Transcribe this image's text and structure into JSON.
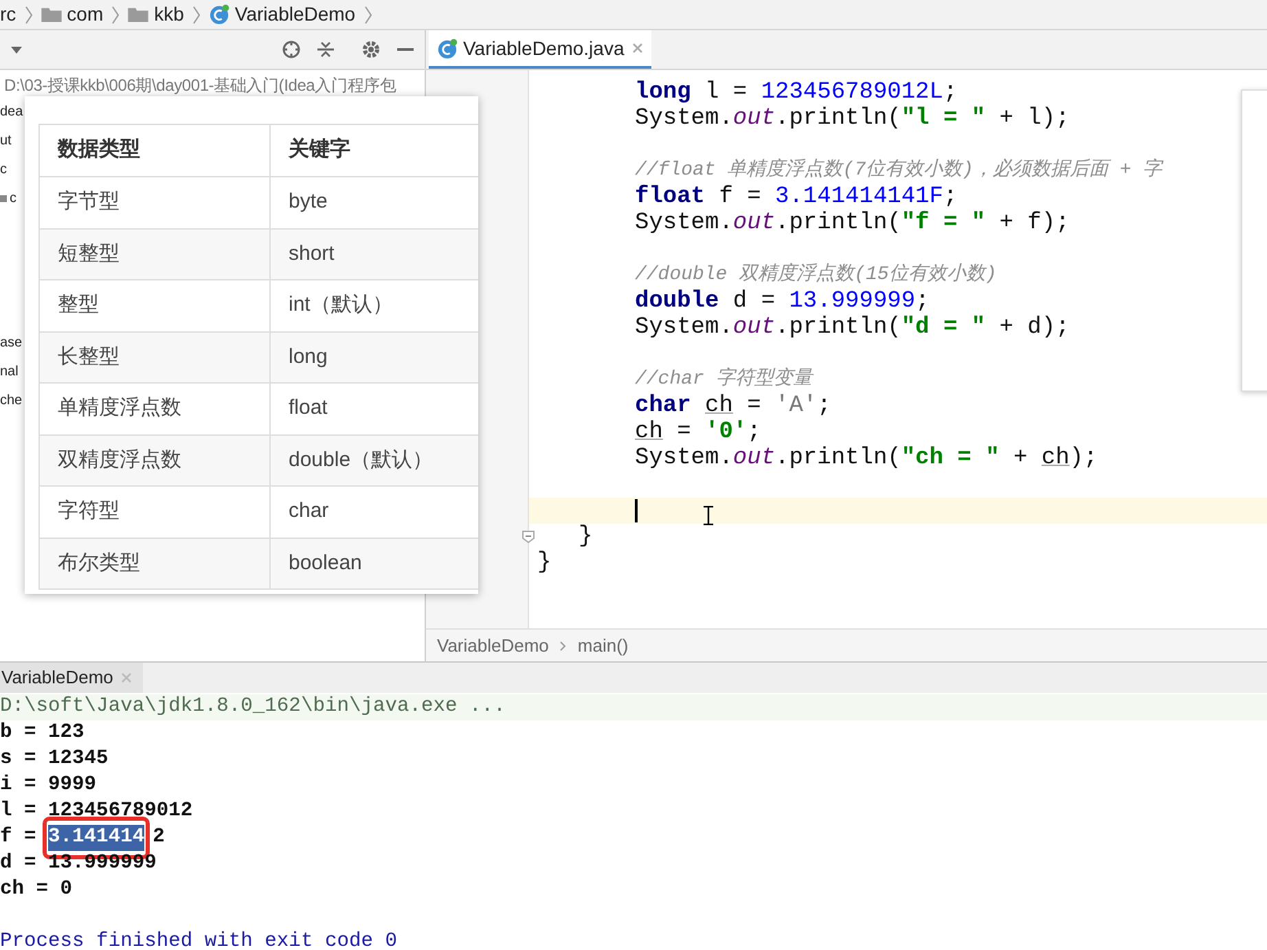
{
  "breadcrumbs": [
    {
      "label": "rc",
      "kind": "text"
    },
    {
      "label": "com",
      "kind": "folder"
    },
    {
      "label": "kkb",
      "kind": "folder"
    },
    {
      "label": "VariableDemo",
      "kind": "class"
    }
  ],
  "project_panel": {
    "path": "D:\\03-授课kkb\\006期\\day001-基础入门(Idea入门程序包",
    "tree_top": [
      {
        "label": "dea",
        "kind": "text"
      },
      {
        "label": "ut",
        "kind": "text"
      },
      {
        "label": "c",
        "kind": "text"
      },
      {
        "label": "c",
        "kind": "folder"
      }
    ],
    "tree_bottom": [
      {
        "label": "ase",
        "kind": "text"
      },
      {
        "label": "nal",
        "kind": "text"
      },
      {
        "label": "che",
        "kind": "text"
      }
    ]
  },
  "editor": {
    "tabs": [
      {
        "label": "VariableDemo.java",
        "selected": true
      }
    ],
    "lines": [
      {
        "kind": "statement",
        "tokens": [
          {
            "t": "long",
            "kind": "keyword"
          },
          {
            "t": " l = ",
            "kind": "plain"
          },
          {
            "t": "123456789012L",
            "kind": "number"
          },
          {
            "t": ";",
            "kind": "plain"
          }
        ]
      },
      {
        "kind": "statement",
        "tokens": [
          {
            "t": "System.",
            "kind": "plain"
          },
          {
            "t": "out",
            "kind": "field"
          },
          {
            "t": ".println(",
            "kind": "plain"
          },
          {
            "t": "\"l = \"",
            "kind": "string"
          },
          {
            "t": " + l);",
            "kind": "plain"
          }
        ]
      },
      {
        "kind": "blank"
      },
      {
        "kind": "statement",
        "tokens": [
          {
            "t": "//float 单精度浮点数(7位有效小数)，必须数据后面 + 字",
            "kind": "comment"
          }
        ]
      },
      {
        "kind": "statement",
        "tokens": [
          {
            "t": "float",
            "kind": "keyword"
          },
          {
            "t": " f = ",
            "kind": "plain"
          },
          {
            "t": "3.141414141F",
            "kind": "number"
          },
          {
            "t": ";",
            "kind": "plain"
          }
        ]
      },
      {
        "kind": "statement",
        "tokens": [
          {
            "t": "System.",
            "kind": "plain"
          },
          {
            "t": "out",
            "kind": "field"
          },
          {
            "t": ".println(",
            "kind": "plain"
          },
          {
            "t": "\"f = \"",
            "kind": "string"
          },
          {
            "t": " + f);",
            "kind": "plain"
          }
        ]
      },
      {
        "kind": "blank"
      },
      {
        "kind": "statement",
        "tokens": [
          {
            "t": "//double 双精度浮点数(15位有效小数)",
            "kind": "comment"
          }
        ]
      },
      {
        "kind": "statement",
        "tokens": [
          {
            "t": "double",
            "kind": "keyword"
          },
          {
            "t": " d = ",
            "kind": "plain"
          },
          {
            "t": "13.999999",
            "kind": "number"
          },
          {
            "t": ";",
            "kind": "plain"
          }
        ]
      },
      {
        "kind": "statement",
        "tokens": [
          {
            "t": "System.",
            "kind": "plain"
          },
          {
            "t": "out",
            "kind": "field"
          },
          {
            "t": ".println(",
            "kind": "plain"
          },
          {
            "t": "\"d = \"",
            "kind": "string"
          },
          {
            "t": " + d);",
            "kind": "plain"
          }
        ]
      },
      {
        "kind": "blank"
      },
      {
        "kind": "statement",
        "tokens": [
          {
            "t": "//char 字符型变量",
            "kind": "comment"
          }
        ]
      },
      {
        "kind": "statement",
        "tokens": [
          {
            "t": "char ",
            "kind": "keyword"
          },
          {
            "t": "ch",
            "kind": "variable"
          },
          {
            "t": " = ",
            "kind": "plain"
          },
          {
            "t": "'A'",
            "kind": "unused"
          },
          {
            "t": ";",
            "kind": "plain"
          }
        ]
      },
      {
        "kind": "statement",
        "tokens": [
          {
            "t": "ch",
            "kind": "variable"
          },
          {
            "t": " = ",
            "kind": "plain"
          },
          {
            "t": "'0'",
            "kind": "string"
          },
          {
            "t": ";",
            "kind": "plain"
          }
        ]
      },
      {
        "kind": "statement",
        "tokens": [
          {
            "t": "System.",
            "kind": "plain"
          },
          {
            "t": "out",
            "kind": "field"
          },
          {
            "t": ".println(",
            "kind": "plain"
          },
          {
            "t": "\"ch = \"",
            "kind": "string"
          },
          {
            "t": " + ",
            "kind": "plain"
          },
          {
            "t": "ch",
            "kind": "variable"
          },
          {
            "t": ");",
            "kind": "plain"
          }
        ]
      },
      {
        "kind": "blank"
      },
      {
        "kind": "caret",
        "current": true
      },
      {
        "kind": "block_end",
        "tokens": [
          {
            "t": "}",
            "kind": "plain"
          }
        ]
      },
      {
        "kind": "class_end",
        "tokens": [
          {
            "t": "}",
            "kind": "plain"
          }
        ]
      }
    ],
    "breadcrumbs": [
      "VariableDemo",
      "main()"
    ]
  },
  "data_types_table": {
    "columns": [
      "数据类型",
      "关键字"
    ],
    "rows": [
      [
        "字节型",
        "byte"
      ],
      [
        "短整型",
        "short"
      ],
      [
        "整型",
        "int（默认）"
      ],
      [
        "长整型",
        "long"
      ],
      [
        "单精度浮点数",
        "float"
      ],
      [
        "双精度浮点数",
        "double（默认）"
      ],
      [
        "字符型",
        "char"
      ],
      [
        "布尔类型",
        "boolean"
      ]
    ]
  },
  "run_panel": {
    "tabs": [
      {
        "label": "VariableDemo",
        "selected": true
      }
    ],
    "lines": [
      {
        "kind": "command",
        "segments": [
          {
            "t": "D:\\soft\\Java\\jdk1.8.0_162\\bin\\java.exe ...",
            "selected": false
          }
        ]
      },
      {
        "kind": "output",
        "segments": [
          {
            "t": "b = 123",
            "selected": false
          }
        ]
      },
      {
        "kind": "output",
        "segments": [
          {
            "t": "s = 12345",
            "selected": false
          }
        ]
      },
      {
        "kind": "output",
        "segments": [
          {
            "t": "i = 9999",
            "selected": false
          }
        ]
      },
      {
        "kind": "output",
        "segments": [
          {
            "t": "l = 123456789012",
            "selected": false
          }
        ]
      },
      {
        "kind": "output",
        "segments": [
          {
            "t": "f = ",
            "selected": false
          },
          {
            "t": "3.141414",
            "selected": true,
            "circled": true
          },
          {
            "t": "2",
            "selected": false
          }
        ]
      },
      {
        "kind": "output",
        "segments": [
          {
            "t": "d = 13.999999",
            "selected": false
          }
        ]
      },
      {
        "kind": "output",
        "segments": [
          {
            "t": "ch = 0",
            "selected": false
          }
        ]
      },
      {
        "kind": "blank"
      },
      {
        "kind": "exit",
        "segments": [
          {
            "t": "Process finished with exit code 0",
            "selected": false
          }
        ]
      }
    ]
  }
}
